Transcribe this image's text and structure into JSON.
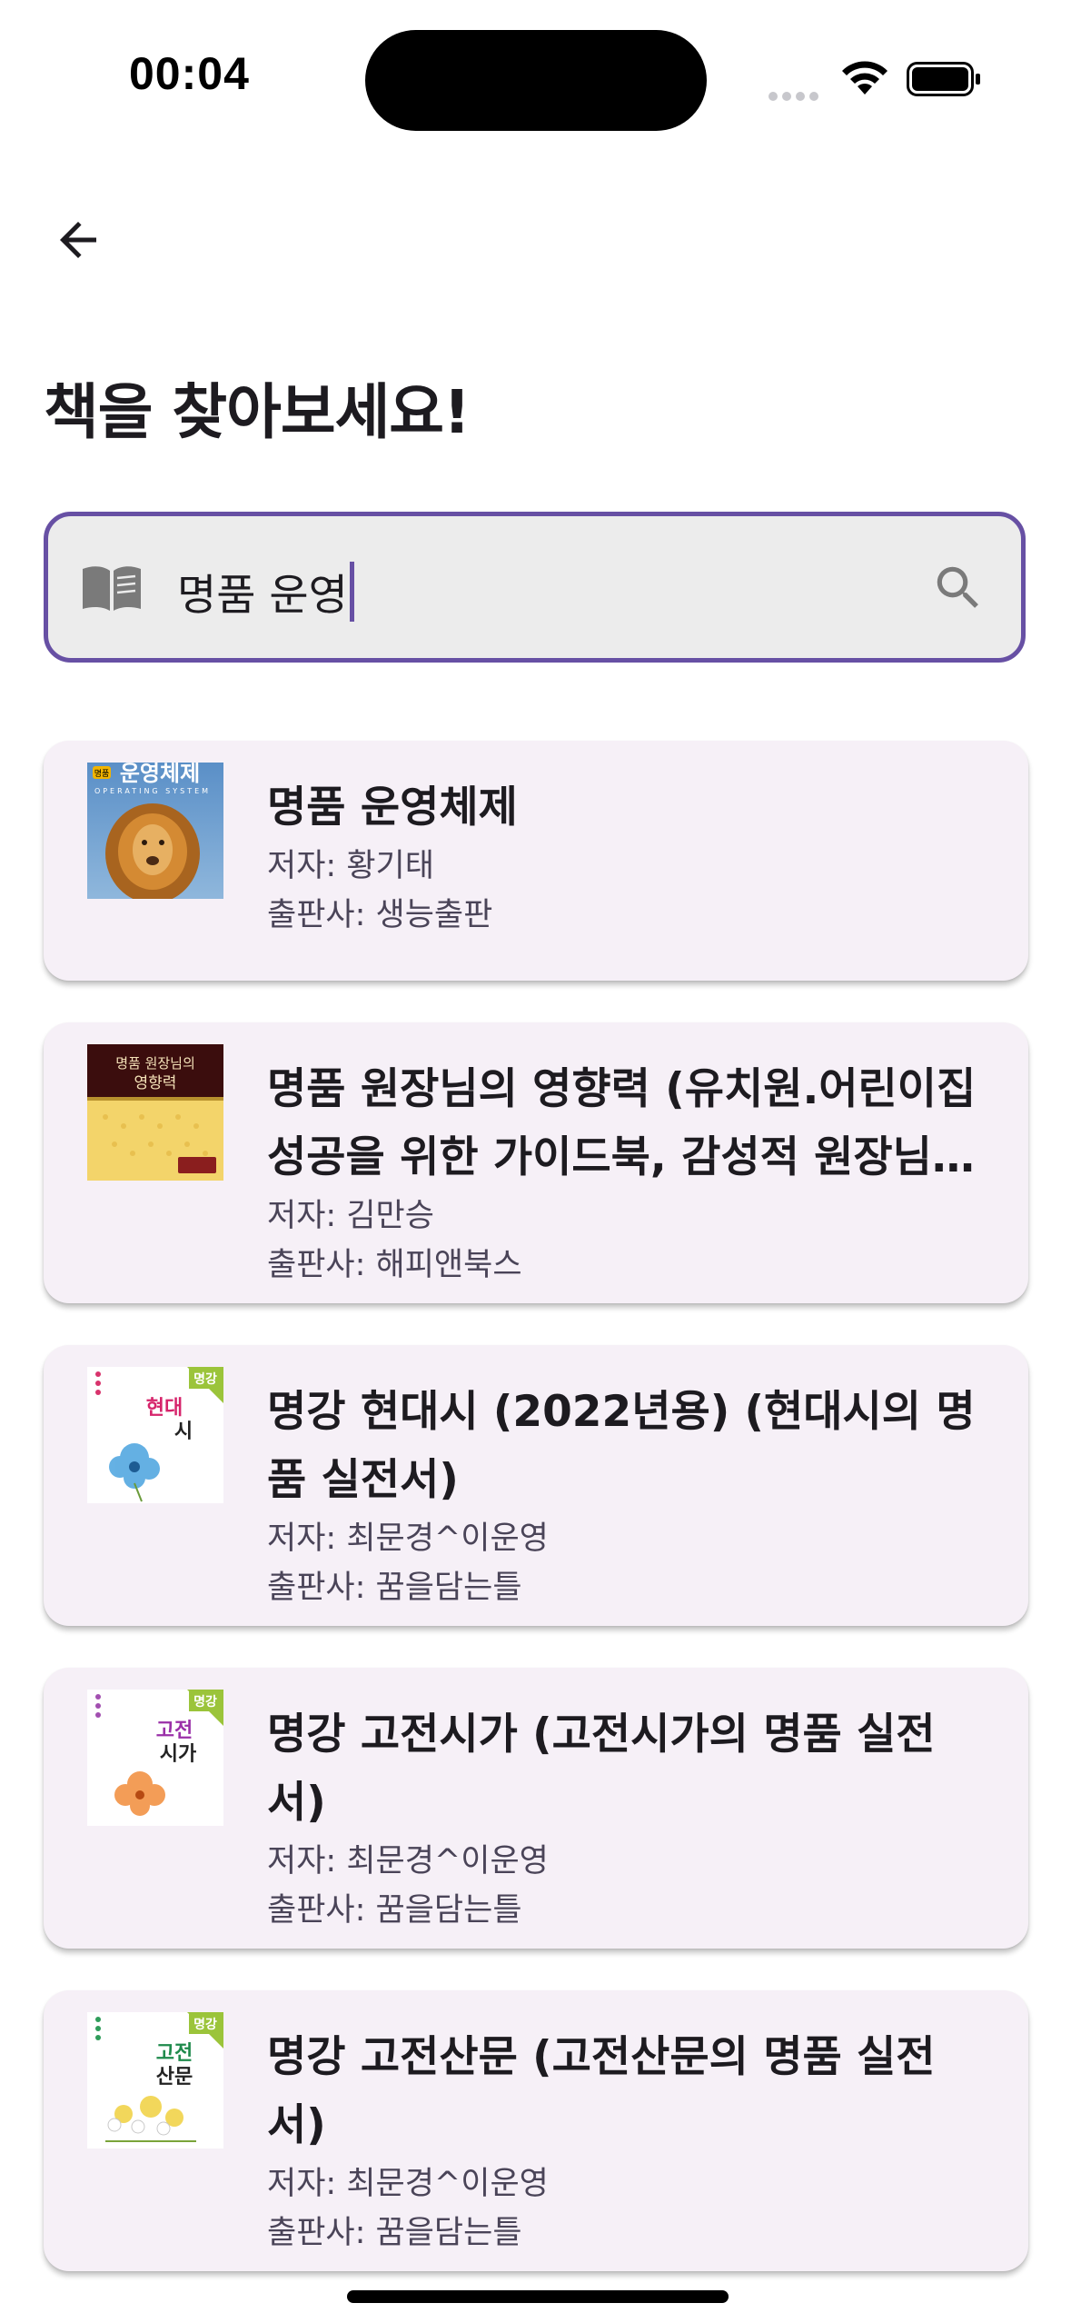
{
  "status_bar": {
    "time": "00:04"
  },
  "header": {
    "title": "책을 찾아보세요!"
  },
  "search": {
    "value": "명품 운영"
  },
  "results": [
    {
      "title": "명품 운영체제",
      "author": "저자: 황기태",
      "publisher": "출판사: 생능출판",
      "cover_text": "운영체제",
      "cover_subtitle": "OPERATING SYSTEM",
      "cover_badge": "명품"
    },
    {
      "title": "명품 원장님의 영향력 (유치원.어린이집 성공을 위한 가이드북, 감성적 원장님이 되는 법)",
      "author": "저자: 김만승",
      "publisher": "출판사: 해피앤북스",
      "cover_text_1": "명품 원장님의",
      "cover_text_2": "영향력"
    },
    {
      "title": "명강 현대시 (2022년용) (현대시의 명품 실전서)",
      "author": "저자: 최문경^이운영",
      "publisher": "출판사: 꿈을담는틀",
      "cover_badge": "명강",
      "cover_text_1": "현대",
      "cover_text_2": "시"
    },
    {
      "title": "명강 고전시가 (고전시가의 명품 실전서)",
      "author": "저자: 최문경^이운영",
      "publisher": "출판사: 꿈을담는틀",
      "cover_badge": "명강",
      "cover_text_1": "고전",
      "cover_text_2": "시가"
    },
    {
      "title": "명강 고전산문 (고전산문의 명품 실전서)",
      "author": "저자: 최문경^이운영",
      "publisher": "출판사: 꿈을담는틀",
      "cover_badge": "명강",
      "cover_text_1": "고전",
      "cover_text_2": "산문"
    }
  ],
  "colors": {
    "accent": "#6750a4",
    "card_bg": "#f6f0f7",
    "search_bg": "#ececec"
  }
}
